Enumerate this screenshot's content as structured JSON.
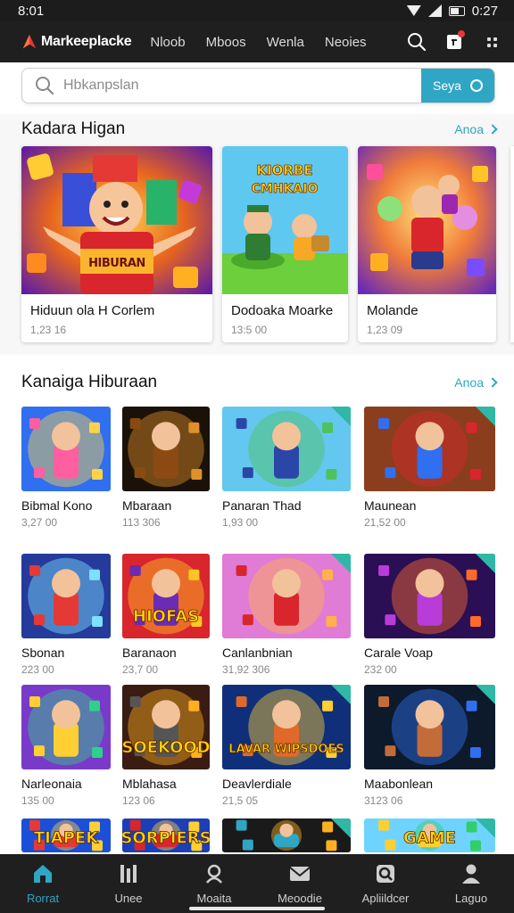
{
  "status_bar": {
    "time": "8:01",
    "right_text": "0:27"
  },
  "app_bar": {
    "brand": "Markeeplacke",
    "nav": [
      "Nloob",
      "Mboos",
      "Wenla",
      "Neoies"
    ]
  },
  "search": {
    "placeholder": "Hbkanpslan",
    "button_label": "Seya"
  },
  "featured": {
    "title": "Kadara Higan",
    "see_all": "Anoa",
    "cards": [
      {
        "name": "Hiduun ola H Corlem",
        "meta": "1,23 16",
        "art_text": "HIBURAN"
      },
      {
        "name": "Dodoaka Moarke",
        "meta": "13:5 00",
        "art_text": "KIORBE CMHKAIO"
      },
      {
        "name": "Molande",
        "meta": "1,23 09",
        "art_text": ""
      }
    ]
  },
  "entertainment": {
    "title": "Kanaiga Hiburaan",
    "see_all": "Anoa",
    "items": [
      {
        "name": "Bibmal Kono",
        "meta": "3,27 00",
        "art_text": ""
      },
      {
        "name": "Mbaraan",
        "meta": "113 306",
        "art_text": ""
      },
      {
        "name": "Panaran Thad",
        "meta": "1,93 00",
        "art_text": ""
      },
      {
        "name": "Maunean",
        "meta": "21,52 00",
        "art_text": ""
      },
      {
        "name": "Sbonan",
        "meta": "223 00",
        "art_text": ""
      },
      {
        "name": "Baranaon",
        "meta": "23,7 00",
        "art_text": "HIOFAS"
      },
      {
        "name": "Canlanbnian",
        "meta": "31,92 306",
        "art_text": ""
      },
      {
        "name": "Carale Voap",
        "meta": "232 00",
        "art_text": ""
      },
      {
        "name": "Narleonaia",
        "meta": "135 00",
        "art_text": ""
      },
      {
        "name": "Mblahasa",
        "meta": "123 06",
        "art_text": "SOEKOOD"
      },
      {
        "name": "Deavlerdiale",
        "meta": "21,5 05",
        "art_text": "LAVAR WIPSDOES"
      },
      {
        "name": "Maabonlean",
        "meta": "3123 06",
        "art_text": ""
      },
      {
        "name": "",
        "meta": "",
        "art_text": "TIAPEK"
      },
      {
        "name": "",
        "meta": "",
        "art_text": "SORPIERS"
      },
      {
        "name": "",
        "meta": "",
        "art_text": ""
      },
      {
        "name": "",
        "meta": "",
        "art_text": "GAME"
      }
    ]
  },
  "bottom_nav": [
    {
      "label": "Rorrat",
      "icon": "home-icon",
      "active": true
    },
    {
      "label": "Unee",
      "icon": "library-icon",
      "active": false
    },
    {
      "label": "Moaita",
      "icon": "discover-icon",
      "active": false
    },
    {
      "label": "Meoodie",
      "icon": "mail-icon",
      "active": false
    },
    {
      "label": "Apliildcer",
      "icon": "search-icon",
      "active": false
    },
    {
      "label": "Laguo",
      "icon": "profile-icon",
      "active": false
    }
  ],
  "colors": {
    "accent": "#2fa6c4",
    "bar": "#1f1f1f"
  }
}
